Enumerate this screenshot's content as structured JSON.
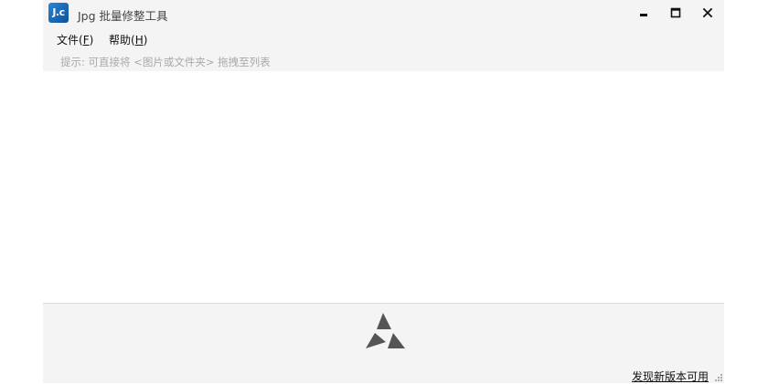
{
  "window": {
    "title": "Jpg 批量修整工具",
    "app_icon_text": "J.c"
  },
  "menu": {
    "file": {
      "label": "文件(",
      "accel": "F",
      "close": ")"
    },
    "help": {
      "label": "帮助(",
      "accel": "H",
      "close": ")"
    }
  },
  "hint": "提示: 可直接将 <图片或文件夹> 拖拽至列表",
  "footer": {
    "update_link": "发现新版本可用"
  },
  "icons": {
    "app": "app-logo-icon",
    "minimize": "minimize-icon",
    "maximize": "maximize-icon",
    "close": "close-icon",
    "footer_logo": "triangle-logo-icon",
    "grip": "resize-grip-icon"
  },
  "colors": {
    "icon_blue": "#1a6fc4",
    "window_bg": "#f4f4f4",
    "hint_gray": "#a9a9a9",
    "logo_gray": "#555555"
  }
}
